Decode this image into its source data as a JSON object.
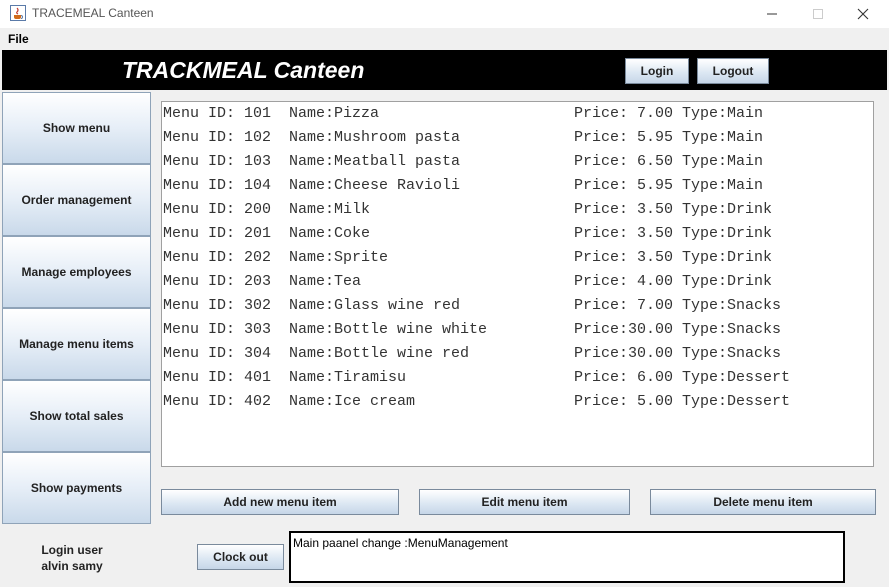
{
  "window": {
    "title": "TRACEMEAL Canteen",
    "app_icon": "java-cup-icon"
  },
  "menubar": {
    "file_label": "File"
  },
  "header": {
    "title": "TRACKMEAL Canteen",
    "login_label": "Login",
    "logout_label": "Logout"
  },
  "sidebar": {
    "items": [
      {
        "label": "Show menu"
      },
      {
        "label": "Order management"
      },
      {
        "label": "Manage employees"
      },
      {
        "label": "Manage menu items"
      },
      {
        "label": "Show total sales"
      },
      {
        "label": "Show payments"
      }
    ]
  },
  "menu_list": {
    "rows": [
      {
        "id": "Menu ID: 101  Name:Pizza",
        "rest": "Price: 7.00 Type:Main"
      },
      {
        "id": "Menu ID: 102  Name:Mushroom pasta",
        "rest": "Price: 5.95 Type:Main"
      },
      {
        "id": "Menu ID: 103  Name:Meatball pasta",
        "rest": "Price: 6.50 Type:Main"
      },
      {
        "id": "Menu ID: 104  Name:Cheese Ravioli",
        "rest": "Price: 5.95 Type:Main"
      },
      {
        "id": "Menu ID: 200  Name:Milk",
        "rest": "Price: 3.50 Type:Drink"
      },
      {
        "id": "Menu ID: 201  Name:Coke",
        "rest": "Price: 3.50 Type:Drink"
      },
      {
        "id": "Menu ID: 202  Name:Sprite",
        "rest": "Price: 3.50 Type:Drink"
      },
      {
        "id": "Menu ID: 203  Name:Tea",
        "rest": "Price: 4.00 Type:Drink"
      },
      {
        "id": "Menu ID: 302  Name:Glass wine red",
        "rest": "Price: 7.00 Type:Snacks"
      },
      {
        "id": "Menu ID: 303  Name:Bottle wine white",
        "rest": "Price:30.00 Type:Snacks"
      },
      {
        "id": "Menu ID: 304  Name:Bottle wine red",
        "rest": "Price:30.00 Type:Snacks"
      },
      {
        "id": "Menu ID: 401  Name:Tiramisu",
        "rest": "Price: 6.00 Type:Dessert"
      },
      {
        "id": "Menu ID: 402  Name:Ice cream",
        "rest": "Price: 5.00 Type:Dessert"
      }
    ]
  },
  "actions": {
    "add_label": "Add new menu item",
    "edit_label": "Edit menu item",
    "delete_label": "Delete menu item"
  },
  "footer": {
    "login_user_label": "Login user",
    "user_name": "alvin samy",
    "clock_out_label": "Clock out",
    "status_text": "Main paanel change :MenuManagement"
  }
}
